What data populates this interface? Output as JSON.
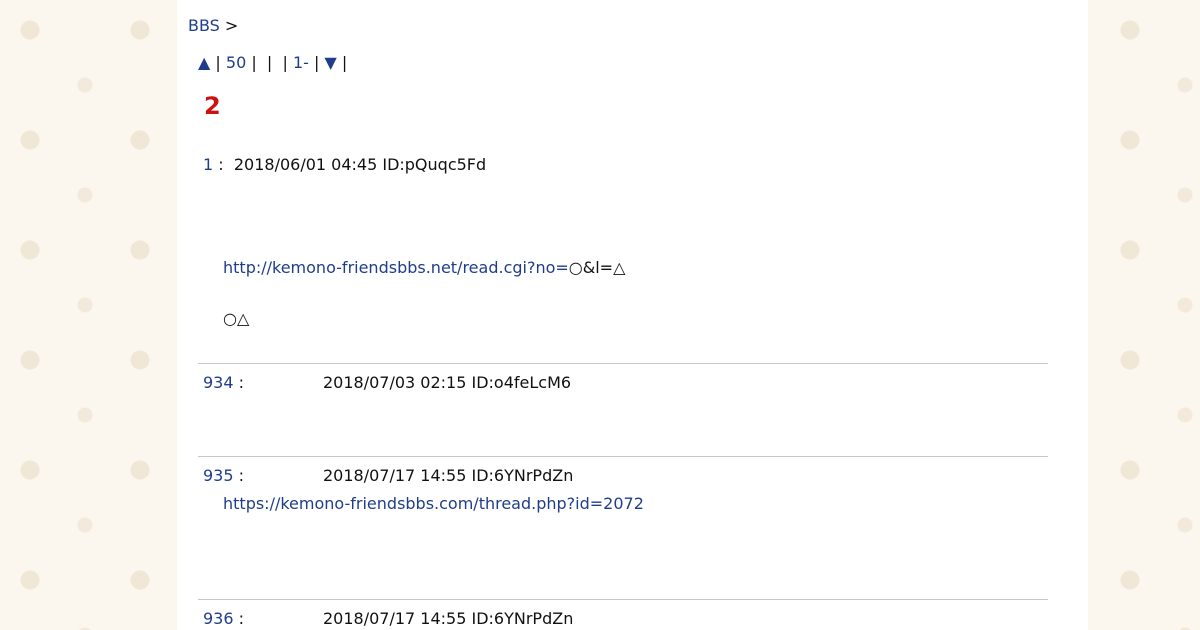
{
  "breadcrumb": {
    "link": "BBS",
    "separator": ">"
  },
  "nav": {
    "up_arrow": "▲",
    "sep": "|",
    "last50": "50",
    "range": "1-",
    "down_arrow": "▼"
  },
  "thread": {
    "title": "2"
  },
  "posts": [
    {
      "number": "1",
      "colon": ":",
      "date": "2018/06/01 04:45 ID:pQuqc5Fd",
      "link": "http://kemono-friendsbbs.net/read.cgi?no=",
      "link_suffix": "○&l=△",
      "line2": "○△"
    },
    {
      "number": "934",
      "colon": ":",
      "date": "2018/07/03 02:15 ID:o4feLcM6"
    },
    {
      "number": "935",
      "colon": ":",
      "date": "2018/07/17 14:55 ID:6YNrPdZn",
      "link": "https://kemono-friendsbbs.com/thread.php?id=2072"
    },
    {
      "number": "936",
      "colon": ":",
      "date": "2018/07/17 14:55 ID:6YNrPdZn"
    }
  ],
  "colors": {
    "link": "#1f3d8a",
    "title": "#cc1111",
    "divider": "#c8c8c8"
  }
}
